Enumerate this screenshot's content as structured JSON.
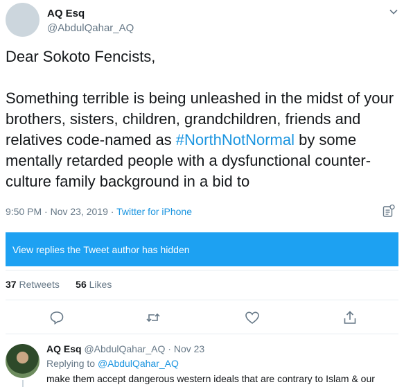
{
  "tweet": {
    "author_name": "AQ Esq",
    "author_handle": "@AbdulQahar_AQ",
    "text_part1": "Dear Sokoto Fencists,\n\nSomething terrible is being unleashed in the midst of your brothers, sisters, children, grandchildren, friends and relatives code-named as ",
    "hashtag": "#NorthNotNormal",
    "text_part2": " by some mentally retarded people with a dysfunctional counter-culture family background in a bid to",
    "time": "9:50 PM · Nov 23, 2019 · ",
    "source": "Twitter for iPhone"
  },
  "hidden_replies_label": "View replies the Tweet author has hidden",
  "stats": {
    "retweets_count": "37",
    "retweets_label": "Retweets",
    "likes_count": "56",
    "likes_label": "Likes"
  },
  "icons": {
    "caret": "chevron-down-icon",
    "analytics": "analytics-icon",
    "reply": "reply-icon",
    "retweet": "retweet-icon",
    "like": "heart-icon",
    "share": "share-icon"
  },
  "reply": {
    "author_name": "AQ Esq",
    "author_handle_date": "@AbdulQahar_AQ · Nov 23",
    "replying_to_label": "Replying to ",
    "replying_to_handle": "@AbdulQahar_AQ",
    "text": "make them accept dangerous western ideals that are contrary to Islam & our"
  },
  "colors": {
    "accent": "#1da1f2",
    "link": "#1b95e0",
    "muted": "#657786"
  }
}
